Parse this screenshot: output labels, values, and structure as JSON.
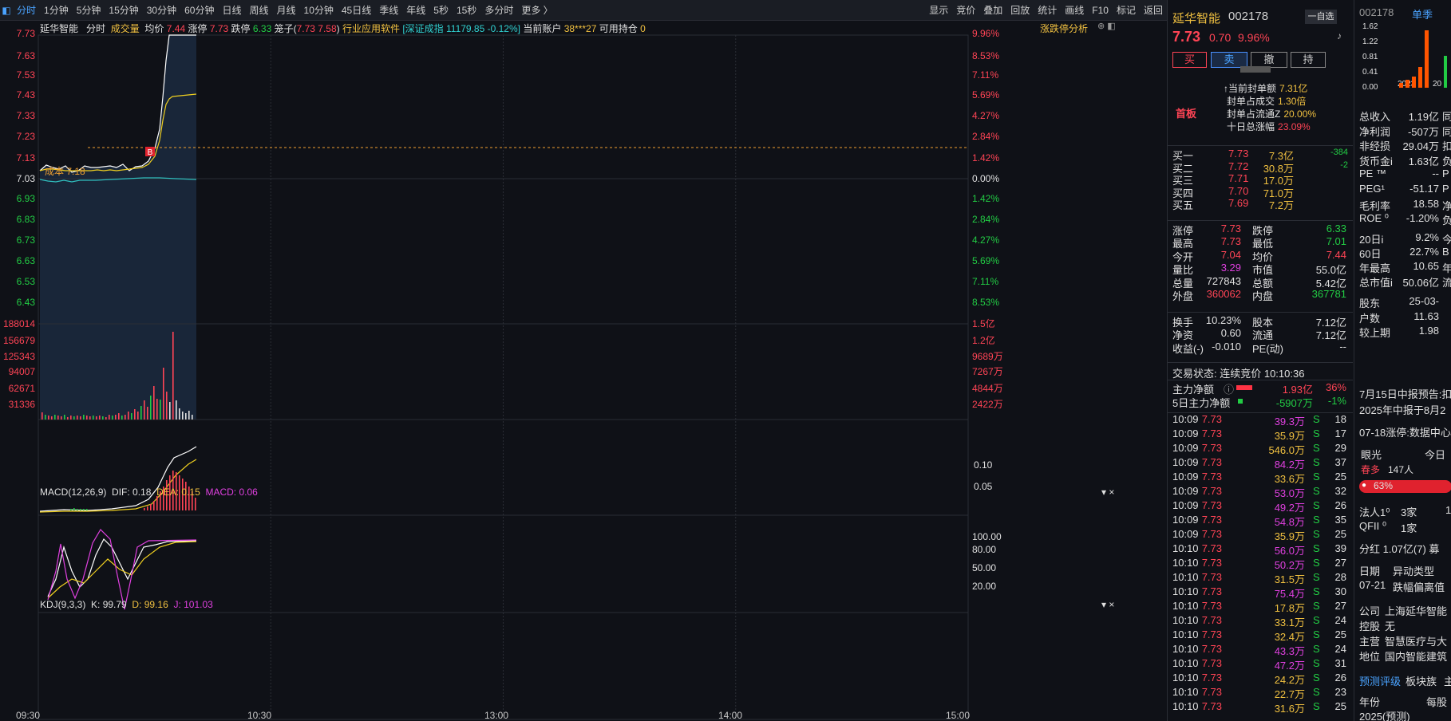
{
  "toolbar": {
    "left_icon": "◧",
    "tabs": [
      "分时",
      "1分钟",
      "5分钟",
      "15分钟",
      "30分钟",
      "60分钟",
      "日线",
      "周线",
      "月线",
      "10分钟",
      "45日线",
      "季线",
      "年线",
      "5秒",
      "15秒",
      "多分时",
      "更多 〉"
    ],
    "right": [
      "显示",
      "竞价",
      "叠加",
      "回放",
      "统计",
      "画线",
      "F10",
      "标记",
      "返回"
    ]
  },
  "info_bar": {
    "name": "延华智能",
    "mode": "分时",
    "volume_label": "成交量",
    "avg_label": "均价",
    "avg": "7.44",
    "up_limit_label": "涨停",
    "up_limit": "7.73",
    "down_limit_label": "跌停",
    "down_limit": "6.33",
    "basket_label": "笼子(",
    "basket": "7.73 7.58",
    "basket_close": ")",
    "industry": "行业应用软件",
    "index": "[深证成指 11179.85 -0.12%]",
    "account_label": "当前账户",
    "account": "38***27",
    "holding_label": "可用持仓",
    "holding": "0",
    "analysis": "涨跌停分析"
  },
  "price_axis": [
    "7.73",
    "7.63",
    "7.53",
    "7.43",
    "7.33",
    "7.23",
    "7.13",
    "7.03",
    "6.93",
    "6.83",
    "6.73",
    "6.63",
    "6.53",
    "6.43"
  ],
  "pct_axis": [
    "9.96%",
    "8.53%",
    "7.11%",
    "5.69%",
    "4.27%",
    "2.84%",
    "1.42%",
    "0.00%",
    "1.42%",
    "2.84%",
    "4.27%",
    "5.69%",
    "7.11%",
    "8.53%"
  ],
  "cost_label": "成本 7.18",
  "buy_marker": "B",
  "vol_axis": [
    "188014",
    "156679",
    "125343",
    "94007",
    "62671",
    "31336"
  ],
  "amount_axis": [
    "1.5亿",
    "1.2亿",
    "9689万",
    "7267万",
    "4844万",
    "2422万"
  ],
  "macd": {
    "title": "MACD(12,26,9)",
    "dif": "DIF: 0.18",
    "dea": "DEA: 0.15",
    "macd": "MACD: 0.06",
    "ticks": [
      "0.10",
      "0.05"
    ]
  },
  "kdj": {
    "title": "KDJ(9,3,3)",
    "k": "K: 99.79",
    "d": "D: 99.16",
    "j": "J: 101.03",
    "ticks": [
      "100.00",
      "80.00",
      "50.00",
      "20.00"
    ]
  },
  "time_axis": [
    "09:30",
    "10:30",
    "13:00",
    "14:00",
    "15:00"
  ],
  "stock": {
    "name": "延华智能",
    "code": "002178",
    "price": "7.73",
    "change": "0.70",
    "pct": "9.96%",
    "watch": "一自选",
    "buy": "买",
    "sell": "卖",
    "cancel": "撤",
    "hold": "持"
  },
  "seal": {
    "first": "首板",
    "lines": [
      [
        "当前封单额",
        "7.31亿"
      ],
      [
        "封单占成交",
        "1.30倍"
      ],
      [
        "封单占流通Z",
        "20.00%"
      ],
      [
        "十日总涨幅",
        "23.09%"
      ]
    ]
  },
  "book": [
    [
      "买一",
      "7.73",
      "7.3亿",
      "-384"
    ],
    [
      "买二",
      "7.72",
      "30.8万",
      "-2"
    ],
    [
      "买三",
      "7.71",
      "17.0万",
      ""
    ],
    [
      "买四",
      "7.70",
      "71.0万",
      ""
    ],
    [
      "买五",
      "7.69",
      "7.2万",
      ""
    ]
  ],
  "stats": [
    [
      "涨停",
      "7.73",
      "跌停",
      "6.33"
    ],
    [
      "最高",
      "7.73",
      "最低",
      "7.01"
    ],
    [
      "今开",
      "7.04",
      "均价",
      "7.44"
    ],
    [
      "量比",
      "3.29",
      "市值",
      "55.0亿"
    ],
    [
      "总量",
      "727843",
      "总额",
      "5.42亿"
    ],
    [
      "外盘",
      "360062",
      "内盘",
      "367781"
    ]
  ],
  "stats2": [
    [
      "换手",
      "10.23%",
      "股本",
      "7.12亿"
    ],
    [
      "净资",
      "0.60",
      "流通",
      "7.12亿"
    ],
    [
      "收益(-)",
      "-0.010",
      "PE(动)",
      "--"
    ]
  ],
  "trade_status": "交易状态: 连续竞价 10:10:36",
  "flow": [
    [
      "主力净额",
      "1.93亿",
      "36%"
    ],
    [
      "5日主力净额",
      "-5907万",
      "-1%"
    ]
  ],
  "ticks": [
    [
      "10:09",
      "7.73",
      "39.3万",
      "S",
      "18"
    ],
    [
      "10:09",
      "7.73",
      "35.9万",
      "S",
      "17"
    ],
    [
      "10:09",
      "7.73",
      "546.0万",
      "S",
      "29"
    ],
    [
      "10:09",
      "7.73",
      "84.2万",
      "S",
      "37"
    ],
    [
      "10:09",
      "7.73",
      "33.6万",
      "S",
      "25"
    ],
    [
      "10:09",
      "7.73",
      "53.0万",
      "S",
      "32"
    ],
    [
      "10:09",
      "7.73",
      "49.2万",
      "S",
      "26"
    ],
    [
      "10:09",
      "7.73",
      "54.8万",
      "S",
      "35"
    ],
    [
      "10:09",
      "7.73",
      "35.9万",
      "S",
      "25"
    ],
    [
      "10:10",
      "7.73",
      "56.0万",
      "S",
      "39"
    ],
    [
      "10:10",
      "7.73",
      "50.2万",
      "S",
      "27"
    ],
    [
      "10:10",
      "7.73",
      "31.5万",
      "S",
      "28"
    ],
    [
      "10:10",
      "7.73",
      "75.4万",
      "S",
      "30"
    ],
    [
      "10:10",
      "7.73",
      "17.8万",
      "S",
      "27"
    ],
    [
      "10:10",
      "7.73",
      "33.1万",
      "S",
      "24"
    ],
    [
      "10:10",
      "7.73",
      "32.4万",
      "S",
      "25"
    ],
    [
      "10:10",
      "7.73",
      "43.3万",
      "S",
      "24"
    ],
    [
      "10:10",
      "7.73",
      "47.2万",
      "S",
      "31"
    ],
    [
      "10:10",
      "7.73",
      "24.2万",
      "S",
      "26"
    ],
    [
      "10:10",
      "7.73",
      "22.7万",
      "S",
      "23"
    ],
    [
      "10:10",
      "7.73",
      "31.6万",
      "S",
      "25"
    ]
  ],
  "fund": {
    "code": "002178",
    "tab": "单季",
    "bar_years": [
      "2023",
      "20"
    ],
    "bar_axis": [
      "1.62",
      "1.22",
      "0.81",
      "0.41",
      "0.00"
    ],
    "rows": [
      [
        "总收入",
        "1.19亿",
        "同"
      ],
      [
        "净利润",
        "-507万",
        "同"
      ],
      [
        "非经损",
        "29.04万",
        "扣"
      ],
      [
        "货币金i",
        "1.63亿",
        "负"
      ],
      [
        "PE ™",
        "--",
        "P"
      ],
      [
        "PEG¹",
        "-51.17",
        "P"
      ],
      [
        "毛利率",
        "18.58",
        "净"
      ],
      [
        "ROE ⁰",
        "-1.20%",
        "负"
      ],
      [
        "20日i",
        "9.2%",
        "今"
      ],
      [
        "60日",
        "22.7%",
        "B"
      ],
      [
        "年最高",
        "10.65",
        "年"
      ],
      [
        "总市值i",
        "50.06亿",
        "流"
      ],
      [
        "股东",
        "25-03-",
        ""
      ],
      [
        "户数",
        "11.63",
        ""
      ],
      [
        "较上期",
        "1.98",
        ""
      ]
    ],
    "notice1": "7月15日中报预告:扣",
    "notice2": "2025年中报于8月2",
    "notice3": "07-18涨停:数据中心",
    "eye": "眼光",
    "today": "今日",
    "spring": "春多",
    "people": "147人",
    "pct": "63%",
    "inst": [
      [
        "法人1⁰",
        "3家",
        "1"
      ],
      [
        "QFII ⁰",
        "1家",
        ""
      ]
    ],
    "dividend": "分红    1.07亿(7)  募",
    "date_h": "日期",
    "type_h": "异动类型",
    "date_r": "07-21",
    "type_r": "跌幅偏离值",
    "company": [
      [
        "公司",
        "上海延华智能"
      ],
      [
        "控股",
        "无"
      ],
      [
        "主营",
        "智慧医疗与大"
      ],
      [
        "地位",
        "国内智能建筑"
      ]
    ],
    "tabs2": [
      "预测评级",
      "板块族",
      "主"
    ],
    "year_h": "年份",
    "eps_h": "每股",
    "year_r": "2025(预测)"
  }
}
